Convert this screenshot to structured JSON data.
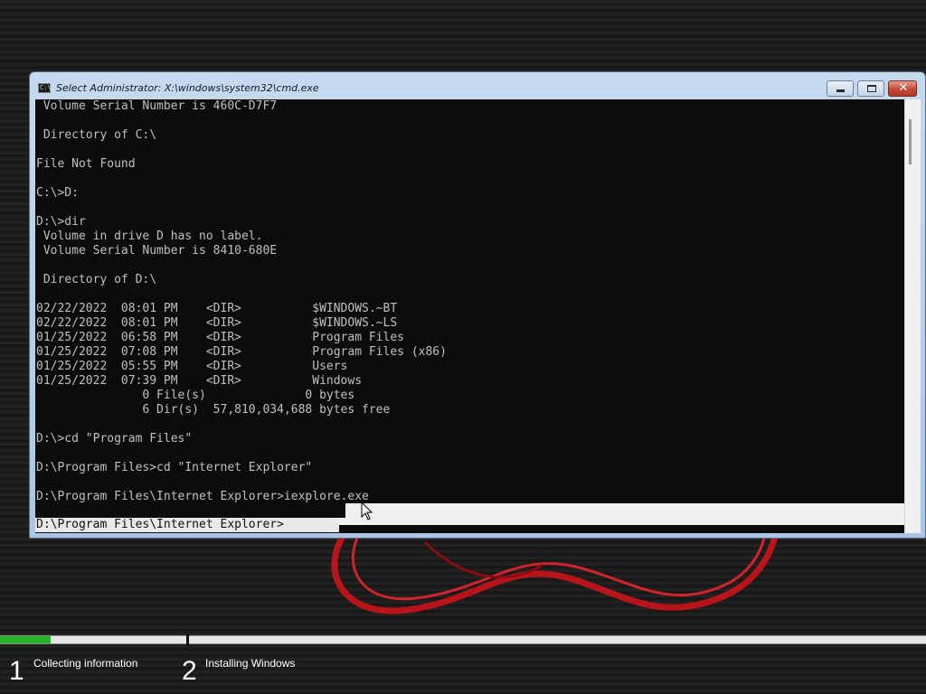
{
  "window": {
    "title": "Select Administrator: X:\\windows\\system32\\cmd.exe",
    "icon": "cmd-icon",
    "icon_text": "C:\\"
  },
  "console": {
    "lines": [
      " Volume Serial Number is 460C-D7F7",
      "",
      " Directory of C:\\",
      "",
      "File Not Found",
      "",
      "C:\\>D:",
      "",
      "D:\\>dir",
      " Volume in drive D has no label.",
      " Volume Serial Number is 8410-680E",
      "",
      " Directory of D:\\",
      "",
      "02/22/2022  08:01 PM    <DIR>          $WINDOWS.~BT",
      "02/22/2022  08:01 PM    <DIR>          $WINDOWS.~LS",
      "01/25/2022  06:58 PM    <DIR>          Program Files",
      "01/25/2022  07:08 PM    <DIR>          Program Files (x86)",
      "01/25/2022  05:55 PM    <DIR>          Users",
      "01/25/2022  07:39 PM    <DIR>          Windows",
      "               0 File(s)              0 bytes",
      "               6 Dir(s)  57,810,034,688 bytes free",
      "",
      "D:\\>cd \"Program Files\"",
      "",
      "D:\\Program Files>cd \"Internet Explorer\"",
      "",
      "D:\\Program Files\\Internet Explorer>iexplore.exe",
      ""
    ],
    "prompt": "D:\\Program Files\\Internet Explorer>"
  },
  "setup": {
    "progress": 0.055,
    "steps": [
      {
        "number": "1",
        "label": "Collecting information"
      },
      {
        "number": "2",
        "label": "Installing Windows"
      }
    ]
  },
  "colors": {
    "console_bg": "#0c0c0c",
    "console_text": "#c0c0c0",
    "progress": "#25b226",
    "close_button": "#c44a36"
  }
}
